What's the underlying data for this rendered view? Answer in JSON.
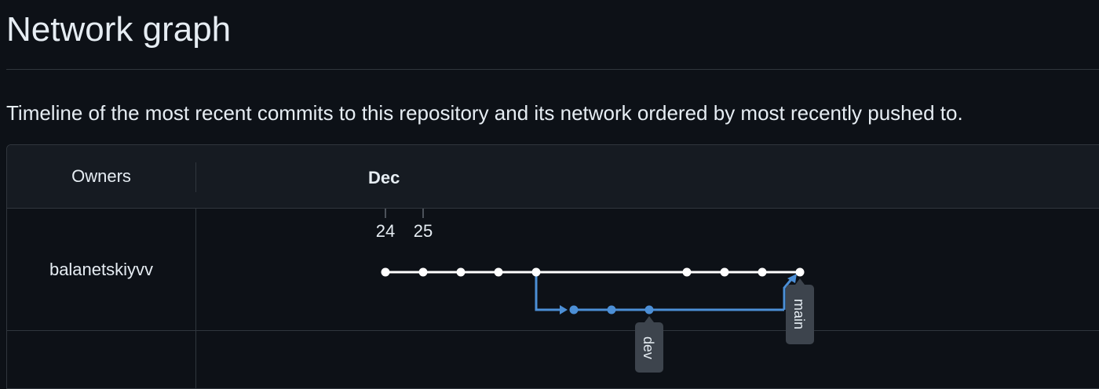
{
  "page": {
    "title": "Network graph",
    "subtitle": "Timeline of the most recent commits to this repository and its network ordered by most recently pushed to."
  },
  "graph": {
    "owners_header": "Owners",
    "month": "Dec",
    "days": [
      "24",
      "25"
    ],
    "owners": [
      "balanetskiyvv"
    ],
    "branches": [
      {
        "name": "main",
        "color": "#ffffff"
      },
      {
        "name": "dev",
        "color": "#4c8fd6"
      }
    ]
  }
}
